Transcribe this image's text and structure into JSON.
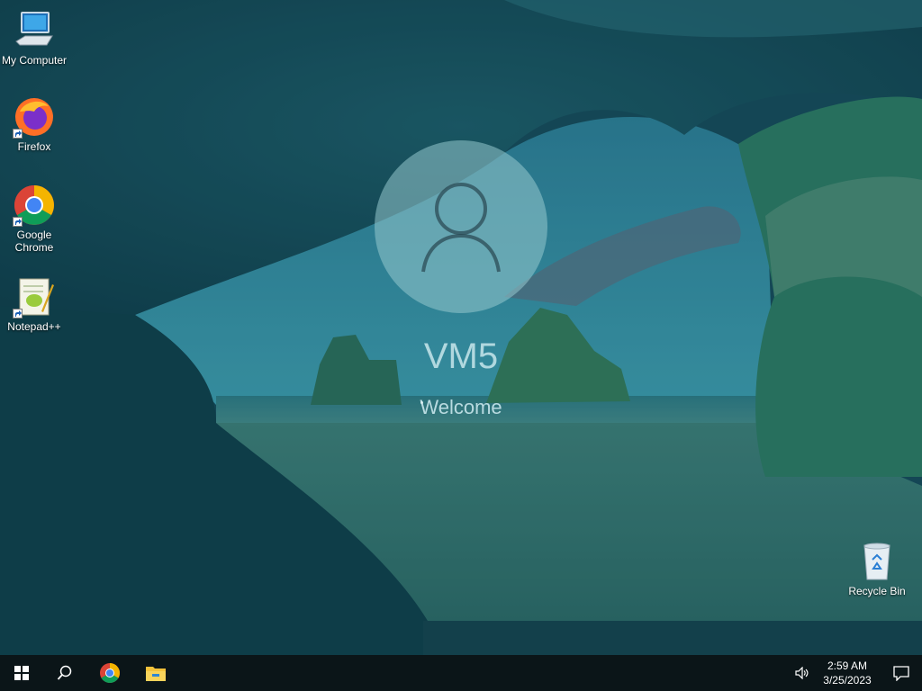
{
  "desktop": {
    "icons": [
      {
        "label": "My Computer",
        "icon": "computer-icon"
      },
      {
        "label": "Firefox",
        "icon": "firefox-icon"
      },
      {
        "label": "Google Chrome",
        "icon": "chrome-icon"
      },
      {
        "label": "Notepad++",
        "icon": "notepadpp-icon"
      },
      {
        "label": "Recycle Bin",
        "icon": "recycle-bin-icon"
      }
    ]
  },
  "login": {
    "username": "VM5",
    "status": "Welcome"
  },
  "taskbar": {
    "buttons": [
      "windows-start-icon",
      "search-icon",
      "chrome-icon",
      "file-explorer-icon"
    ],
    "tray": {
      "volume_icon": "volume-icon",
      "time": "2:59 AM",
      "date": "3/25/2023",
      "notification_icon": "notification-icon"
    }
  },
  "colors": {
    "taskbar": "#0b1518",
    "overlay": "#0a3c48",
    "text": "#ffffff"
  }
}
